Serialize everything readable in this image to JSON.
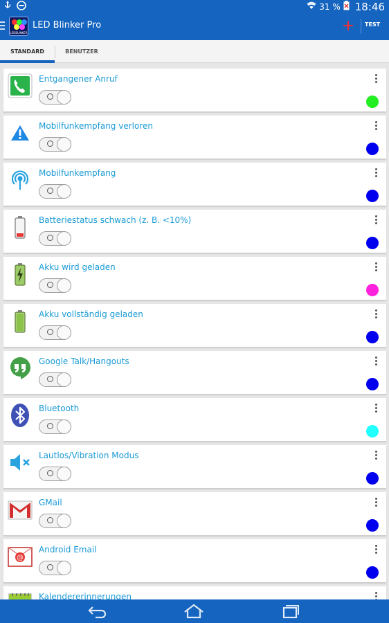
{
  "status_bar": {
    "battery_percent": "31 %",
    "time": "18:46",
    "icons": [
      "usb-icon",
      "do-not-disturb-icon",
      "wifi-icon",
      "battery-icon"
    ]
  },
  "action_bar": {
    "app_title": "LED Blinker Pro",
    "app_icon_text": "LEDBLINKER",
    "add_label": "+",
    "test_label": "TEST"
  },
  "tabs": [
    {
      "label": "STANDARD",
      "selected": true
    },
    {
      "label": "BENUTZER",
      "selected": false
    }
  ],
  "items": [
    {
      "label": "Entgangener Anruf",
      "icon": "missed-call-icon",
      "enabled": false,
      "color": "#22ee22"
    },
    {
      "label": "Mobilfunkempfang verloren",
      "icon": "signal-warning-icon",
      "enabled": false,
      "color": "#0000ee"
    },
    {
      "label": "Mobilfunkempfang",
      "icon": "antenna-icon",
      "enabled": false,
      "color": "#0000ee"
    },
    {
      "label": "Batteriestatus schwach (z. B. <10%)",
      "icon": "battery-low-icon",
      "enabled": false,
      "color": "#0000ee"
    },
    {
      "label": "Akku wird geladen",
      "icon": "battery-charging-icon",
      "enabled": false,
      "color": "#ff22dd"
    },
    {
      "label": "Akku vollständig geladen",
      "icon": "battery-full-icon",
      "enabled": false,
      "color": "#0000ee"
    },
    {
      "label": "Google Talk/Hangouts",
      "icon": "hangouts-icon",
      "enabled": false,
      "color": "#0000ee"
    },
    {
      "label": "Bluetooth",
      "icon": "bluetooth-icon",
      "enabled": false,
      "color": "#22ffff"
    },
    {
      "label": "Lautlos/Vibration Modus",
      "icon": "mute-icon",
      "enabled": false,
      "color": "#0000ee"
    },
    {
      "label": "GMail",
      "icon": "gmail-icon",
      "enabled": false,
      "color": "#0000ee"
    },
    {
      "label": "Android Email",
      "icon": "email-icon",
      "enabled": false,
      "color": "#0000ee"
    },
    {
      "label": "Kalendererinnerungen",
      "icon": "calendar-icon",
      "enabled": false,
      "color": "#0000ee"
    }
  ],
  "toggle_off_glyph": "O",
  "nav_bar": [
    "back-icon",
    "home-icon",
    "recent-apps-icon"
  ]
}
